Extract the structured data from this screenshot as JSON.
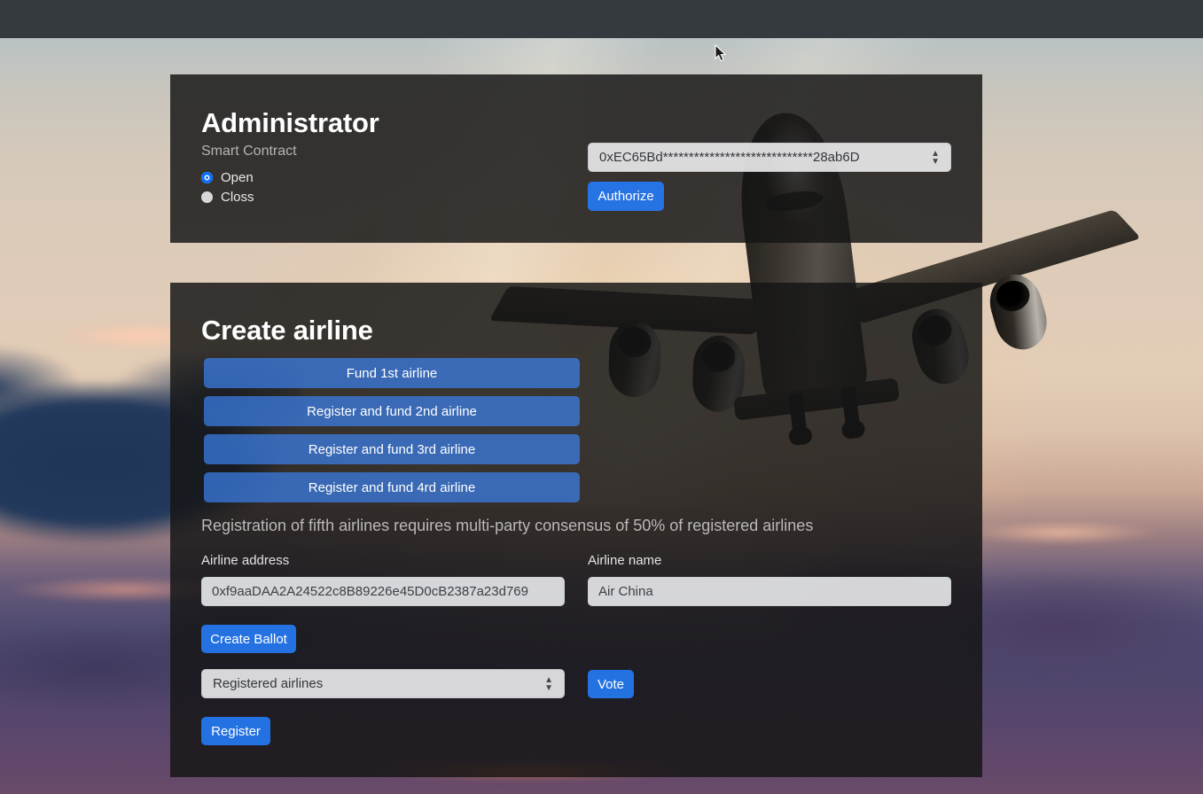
{
  "page": {
    "background_description": "airplane taking off at sunset",
    "topbar_color": "#343a3e"
  },
  "admin_panel": {
    "title": "Administrator",
    "subtitle": "Smart Contract",
    "radios": [
      {
        "label": "Open",
        "selected": true
      },
      {
        "label": "Closs",
        "selected": false
      }
    ],
    "contract_select": {
      "value": "0xEC65Bd*****************************28ab6D"
    },
    "authorize_button": "Authorize"
  },
  "create_panel": {
    "title": "Create airline",
    "fund_buttons": [
      "Fund 1st airline",
      "Register and fund 2nd airline",
      "Register and fund 3rd airline",
      "Register and fund 4rd airline"
    ],
    "consensus_note": "Registration of fifth airlines requires multi-party consensus of 50% of registered airlines",
    "airline_address": {
      "label": "Airline address",
      "value": "0xf9aaDAA2A24522c8B89226e45D0cB2387a23d769",
      "placeholder": "Airline address"
    },
    "airline_name": {
      "label": "Airline name",
      "value": "Air China",
      "placeholder": "Airline name"
    },
    "create_ballot_button": "Create Ballot",
    "registered_select": {
      "value": "Registered airlines"
    },
    "vote_button": "Vote",
    "register_button": "Register"
  },
  "colors": {
    "accent_blue": "#2579f1",
    "panel_bg": "rgba(21,21,21,0.84)",
    "radio_on": "#0d6efd"
  },
  "icons": {
    "select_chevron": "↕"
  }
}
